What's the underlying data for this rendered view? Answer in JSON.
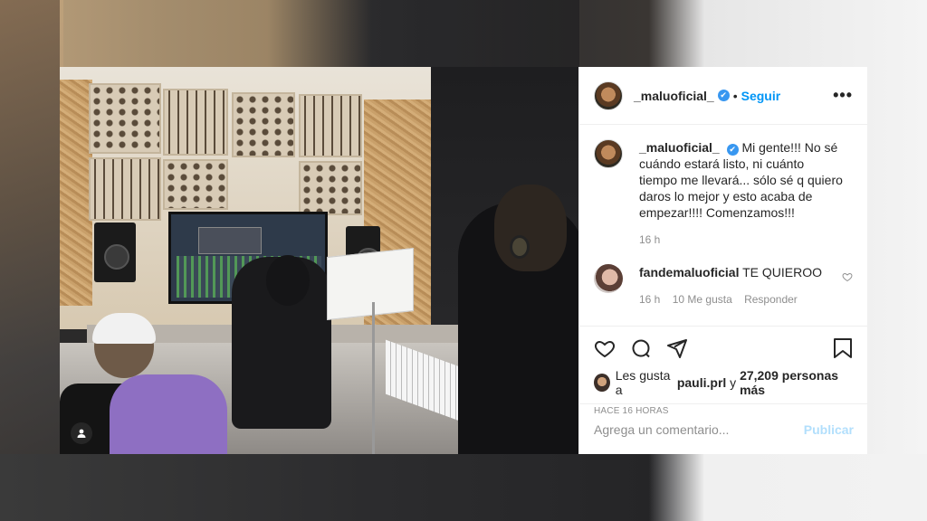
{
  "post": {
    "username": "_maluoficial_",
    "verified_mark": "✔",
    "separator": "•",
    "follow_label": "Seguir",
    "more_label": "•••",
    "caption": "Mi gente!!! No sé cuándo estará listo, ni cuánto tiempo me llevará... sólo sé q quiero daros lo mejor y esto acaba de empezar!!!! Comenzamos!!!",
    "caption_time": "16 h"
  },
  "comment": {
    "username": "fandemaluoficial",
    "text": "TE QUIEROO",
    "time": "16 h",
    "likes": "10 Me gusta",
    "reply": "Responder"
  },
  "likes": {
    "prefix": "Les gusta a",
    "user": "pauli.prl",
    "connector": "y",
    "count": "27,209 personas más"
  },
  "posted_ago": "HACE 16 HORAS",
  "add_comment": {
    "placeholder": "Agrega un comentario...",
    "publish_label": "Publicar"
  },
  "icons": [
    "heart-icon",
    "comment-icon",
    "share-icon",
    "bookmark-icon",
    "user-tag-icon",
    "more-icon",
    "verified-icon"
  ],
  "colors": {
    "link_blue": "#0095f6",
    "publish_disabled": "#b2dffc",
    "verified_blue": "#3897f0",
    "text": "#262626",
    "muted": "#8e8e8e"
  }
}
